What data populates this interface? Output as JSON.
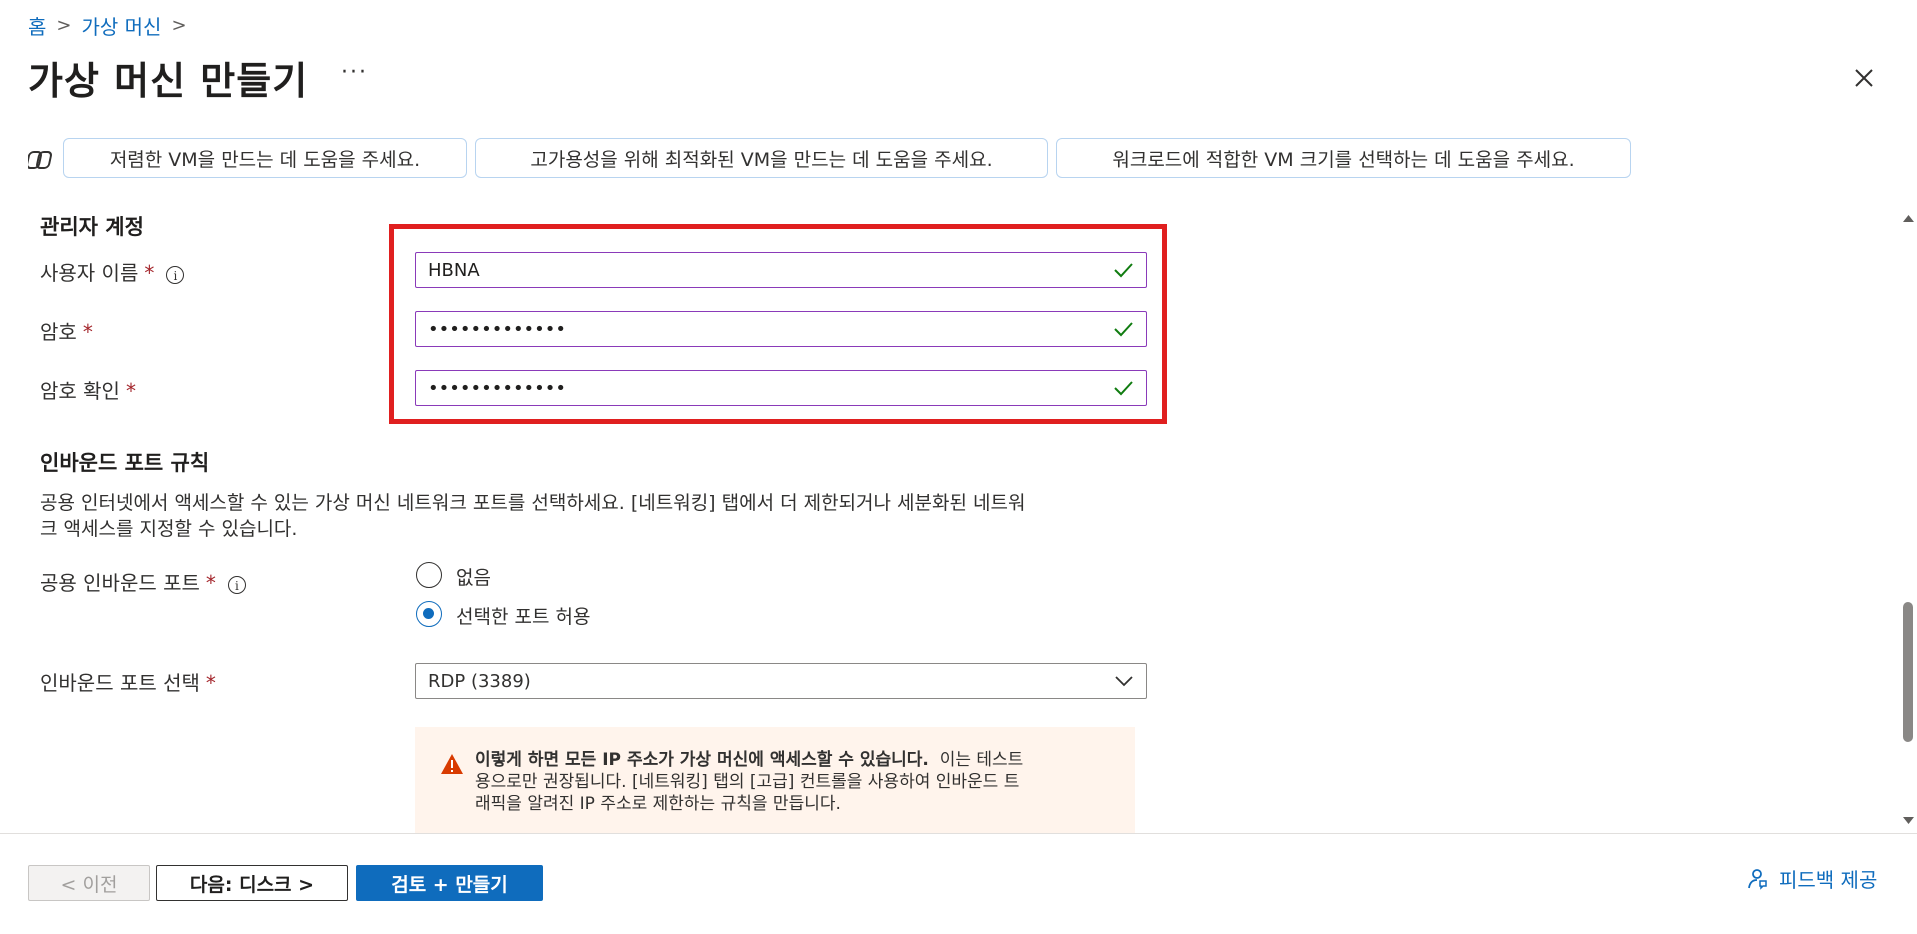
{
  "breadcrumb": {
    "home": "홈",
    "parent": "가상 머신"
  },
  "header": {
    "title": "가상 머신 만들기",
    "more": "···"
  },
  "prompts": [
    "저렴한 VM을 만드는 데 도움을 주세요.",
    "고가용성을 위해 최적화된 VM을 만드는 데 도움을 주세요.",
    "워크로드에 적합한 VM 크기를 선택하는 데 도움을 주세요."
  ],
  "admin_account": {
    "section_title": "관리자 계정",
    "username_label": "사용자 이름",
    "username_value": "HBNA",
    "password_label": "암호",
    "password_value": "•••••••••••••",
    "confirm_label": "암호 확인",
    "confirm_value": "•••••••••••••"
  },
  "required_mark": "*",
  "inbound": {
    "section_title": "인바운드 포트 규칙",
    "description_line1": "공용 인터넷에서 액세스할 수 있는 가상 머신 네트워크 포트를 선택하세요. [네트워킹] 탭에서 더 제한되거나 세분화된 네트워",
    "description_line2": "크 액세스를 지정할 수 있습니다.",
    "public_ports_label": "공용 인바운드 포트",
    "option_none": "없음",
    "option_allow": "선택한 포트 허용",
    "selected_option": "선택한 포트 허용",
    "select_ports_label": "인바운드 포트 선택",
    "select_ports_value": "RDP (3389)",
    "warning_bold": "이렇게 하면 모든 IP 주소가 가상 머신에 액세스할 수 있습니다.",
    "warning_line1_rest": "이는 테스트",
    "warning_line2": "용으로만 권장됩니다.  [네트워킹] 탭의 [고급] 컨트롤을 사용하여 인바운드 트",
    "warning_line3": "래픽을 알려진 IP 주소로 제한하는 규칙을 만듭니다."
  },
  "footer": {
    "prev": "< 이전",
    "next": "다음: 디스크 >",
    "review": "검토 + 만들기",
    "feedback": "피드백 제공"
  },
  "colors": {
    "accent": "#0f6cbd",
    "highlight": "#e01f1f",
    "input_border": "#8a3ab9",
    "valid": "#107c10",
    "warning_bg": "#fff4ec",
    "warning_icon": "#d83b01"
  }
}
